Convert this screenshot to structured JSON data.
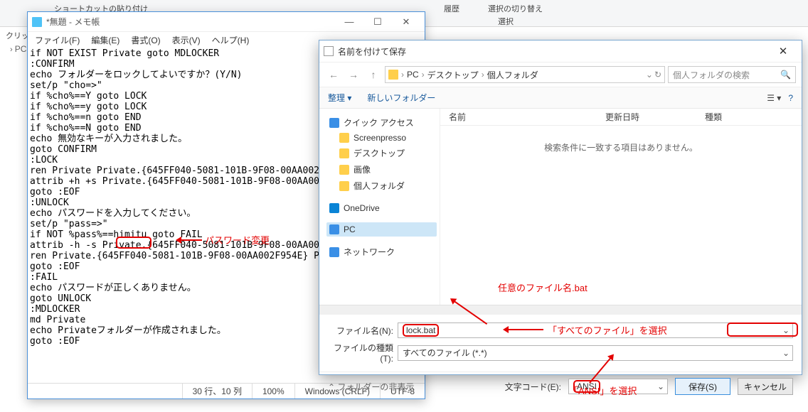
{
  "ribbon": {
    "paste_shortcut": "ショートカットの貼り付け",
    "history": "履歴",
    "toggle_sel": "選択の切り替え",
    "select_group": "選択"
  },
  "left_breadcrumb": "PC",
  "notepad": {
    "title": "*無題 - メモ帳",
    "menu": [
      "ファイル(F)",
      "編集(E)",
      "書式(O)",
      "表示(V)",
      "ヘルプ(H)"
    ],
    "body": "if NOT EXIST Private goto MDLOCKER\n:CONFIRM\necho フォルダーをロックしてよいですか？(Y/N)\nset/p \"cho=>\"\nif %cho%==Y goto LOCK\nif %cho%==y goto LOCK\nif %cho%==n goto END\nif %cho%==N goto END\necho 無効なキーが入力されました。\ngoto CONFIRM\n:LOCK\nren Private Private.{645FF040-5081-101B-9F08-00AA002\nattrib +h +s Private.{645FF040-5081-101B-9F08-00AA00\ngoto :EOF\n:UNLOCK\necho パスワードを入力してください。\nset/p \"pass=>\"\nif NOT %pass%==himitu goto FAIL\nattrib -h -s Private.{645FF040-5081-101B-9F08-00AA00\nren Private.{645FF040-5081-101B-9F08-00AA002F954E} P\ngoto :EOF\n:FAIL\necho パスワードが正しくありません。\ngoto UNLOCK\n:MDLOCKER\nmd Private\necho Privateフォルダーが作成されました。\ngoto :EOF",
    "status": {
      "pos": "30 行、10 列",
      "zoom": "100%",
      "eol": "Windows (CRLF)",
      "enc": "UTF-8"
    }
  },
  "dialog": {
    "title": "名前を付けて保存",
    "breadcrumb": [
      "PC",
      "デスクトップ",
      "個人フォルダ"
    ],
    "search_placeholder": "個人フォルダの検索",
    "organize": "整理",
    "new_folder": "新しいフォルダー",
    "tree": {
      "quick": "クイック アクセス",
      "items": [
        "Screenpresso",
        "デスクトップ",
        "画像",
        "個人フォルダ"
      ],
      "onedrive": "OneDrive",
      "pc": "PC",
      "network": "ネットワーク"
    },
    "columns": {
      "name": "名前",
      "date": "更新日時",
      "type": "種類"
    },
    "empty": "検索条件に一致する項目はありません。",
    "filename_label": "ファイル名(N):",
    "filename_value": "lock.bat",
    "filetype_label": "ファイルの種類(T):",
    "filetype_value": "すべてのファイル (*.*)",
    "encoding_label": "文字コード(E):",
    "encoding_value": "ANSI",
    "hide_folders": "フォルダーの非表示",
    "save": "保存(S)",
    "cancel": "キャンセル"
  },
  "annotations": {
    "password": "パスワード変更",
    "filename": "任意のファイル名.bat",
    "filetype": "「すべてのファイル」を選択",
    "encoding": "「ANSI」を選択"
  }
}
